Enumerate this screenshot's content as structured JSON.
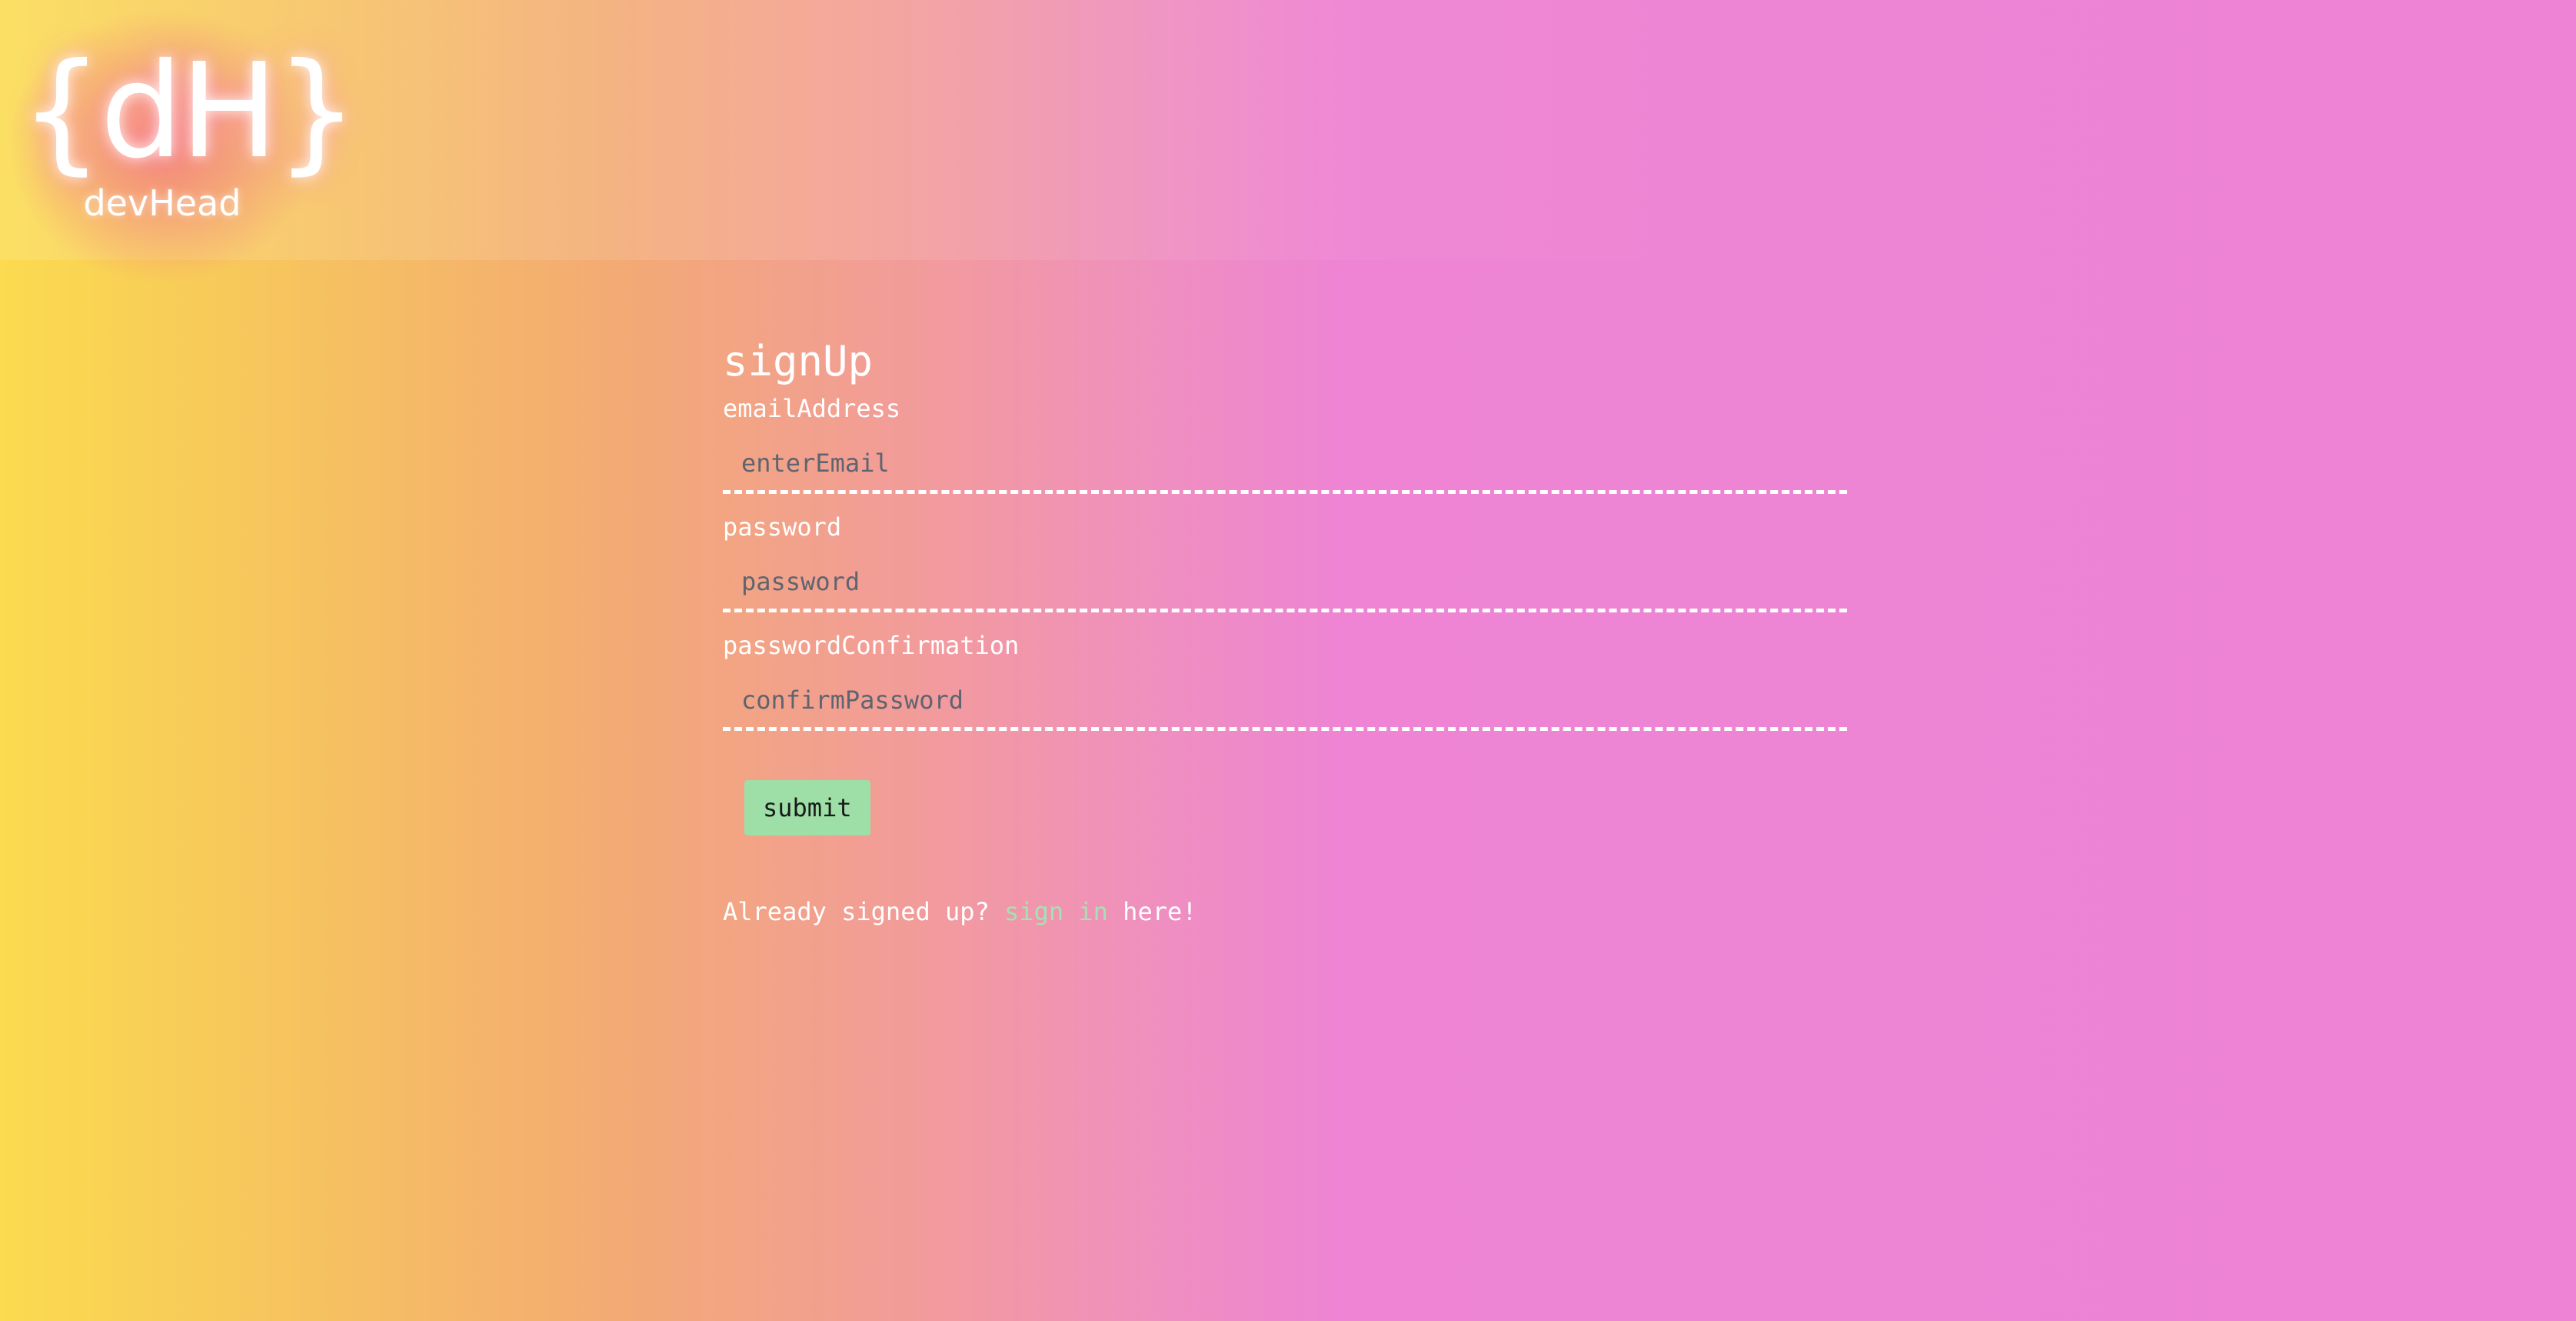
{
  "header": {
    "logo_mark": "{dH}",
    "logo_text": "devHead"
  },
  "form": {
    "title": "signUp",
    "email_label": "emailAddress",
    "email_placeholder": "enterEmail",
    "password_label": "password",
    "password_placeholder": "password",
    "confirm_label": "passwordConfirmation",
    "confirm_placeholder": "confirmPassword",
    "submit_label": "submit"
  },
  "footer": {
    "prefix": "Already signed up? ",
    "link_text": "sign in",
    "suffix": " here!"
  },
  "colors": {
    "gradient_start": "#fbdb4f",
    "gradient_end": "#ee83d6",
    "submit_bg": "#9ddfa6",
    "link": "#a6e1b4"
  }
}
